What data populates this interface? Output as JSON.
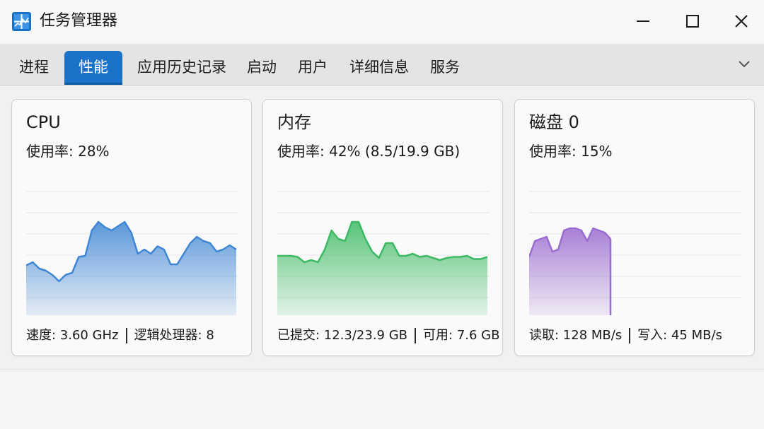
{
  "window": {
    "title": "任务管理器",
    "accent": "#1b73c9"
  },
  "tabs": [
    {
      "label": "进程"
    },
    {
      "label": "性能"
    },
    {
      "label": "应用历史记录"
    },
    {
      "label": "启动"
    },
    {
      "label": "用户"
    },
    {
      "label": "详细信息"
    },
    {
      "label": "服务"
    }
  ],
  "active_tab": "性能",
  "cards": {
    "cpu": {
      "title": "CPU",
      "usage": "使用率: 28%",
      "footer_left": "速度: 3.60 GHz",
      "footer_right": "逻辑处理器: 8",
      "color": "#3f86d4",
      "history": [
        0.47,
        0.5,
        0.44,
        0.42,
        0.38,
        0.32,
        0.38,
        0.4,
        0.55,
        0.56,
        0.8,
        0.88,
        0.83,
        0.8,
        0.84,
        0.88,
        0.78,
        0.58,
        0.62,
        0.58,
        0.65,
        0.62,
        0.48,
        0.48,
        0.58,
        0.68,
        0.74,
        0.7,
        0.68,
        0.6,
        0.62,
        0.66,
        0.62
      ]
    },
    "memory": {
      "title": "内存",
      "usage": "使用率: 42% (8.5/19.9 GB)",
      "footer_left": "已提交: 12.3/23.9 GB",
      "footer_right": "可用: 7.6 GB",
      "color": "#3cba63",
      "history": [
        0.56,
        0.56,
        0.56,
        0.55,
        0.5,
        0.52,
        0.5,
        0.62,
        0.8,
        0.72,
        0.7,
        0.88,
        0.88,
        0.72,
        0.6,
        0.54,
        0.68,
        0.68,
        0.56,
        0.56,
        0.58,
        0.55,
        0.56,
        0.54,
        0.52,
        0.54,
        0.55,
        0.55,
        0.56,
        0.53,
        0.53,
        0.55
      ]
    },
    "disk": {
      "title": "磁盘 0",
      "usage": "使用率: 15%",
      "footer_left": "读取: 128 MB/s",
      "footer_right": "写入: 45 MB/s",
      "color": "#9a6ccf",
      "history": [
        0.55,
        0.7,
        0.72,
        0.74,
        0.6,
        0.62,
        0.8,
        0.82,
        0.82,
        0.8,
        0.7,
        0.82,
        0.8,
        0.78,
        0.72
      ]
    }
  }
}
